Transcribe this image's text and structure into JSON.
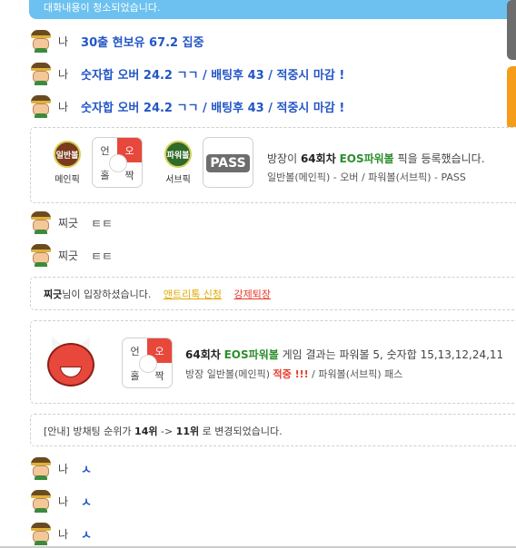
{
  "notice": {
    "text": "대화내용이 청소되었습니다."
  },
  "messages_top": [
    {
      "nick": "나",
      "text": "30출 현보유 67.2 집중"
    },
    {
      "nick": "나",
      "text": "숫자합 오버 24.2 ㄱㄱ / 배팅후 43 / 적중시 마감 !"
    },
    {
      "nick": "나",
      "text": "숫자합 오버 24.2 ㄱㄱ / 배팅후 43 / 적중시 마감 !"
    }
  ],
  "pick_card": {
    "main_ball": "일반볼",
    "main_label": "메인픽",
    "grid1": [
      "언",
      "오",
      "홀",
      "짝"
    ],
    "sub_ball": "파워볼",
    "sub_label": "서브픽",
    "pass": "PASS",
    "line1_prefix": "방장이",
    "round": "64회차",
    "game": "EOS파워볼",
    "line1_suffix": "픽을 등록했습니다.",
    "line2": "일반볼(메인픽) - 오버 / 파워볼(서브픽) - PASS"
  },
  "messages_mid": [
    {
      "nick": "찌긋",
      "text": "ㅌㅌ"
    },
    {
      "nick": "찌긋",
      "text": "ㅌㅌ"
    }
  ],
  "entry": {
    "nick": "찌긋",
    "text": "님이 입장하셨습니다.",
    "link1": "앤트리톡 신청",
    "link2": "강제퇴장"
  },
  "result_card": {
    "grid": [
      "언",
      "오",
      "홀",
      "짝"
    ],
    "round": "64회차",
    "game": "EOS파워볼",
    "text1": "게임 결과는 파워볼 5, 숫자합 15,13,12,24,11",
    "text2_prefix": "방장 일반볼(메인픽)",
    "hit": "적중 !!!",
    "text2_suffix": "/ 파워볼(서브픽) 패스"
  },
  "rank_notice": {
    "prefix": "[안내] 방채팅 순위가",
    "from": "14위",
    "arrow": "->",
    "to": "11위",
    "suffix": "로 변경되었습니다."
  },
  "messages_bottom": [
    {
      "nick": "나",
      "text": "ㅅ"
    },
    {
      "nick": "나",
      "text": "ㅅ"
    },
    {
      "nick": "나",
      "text": "ㅅ"
    }
  ]
}
